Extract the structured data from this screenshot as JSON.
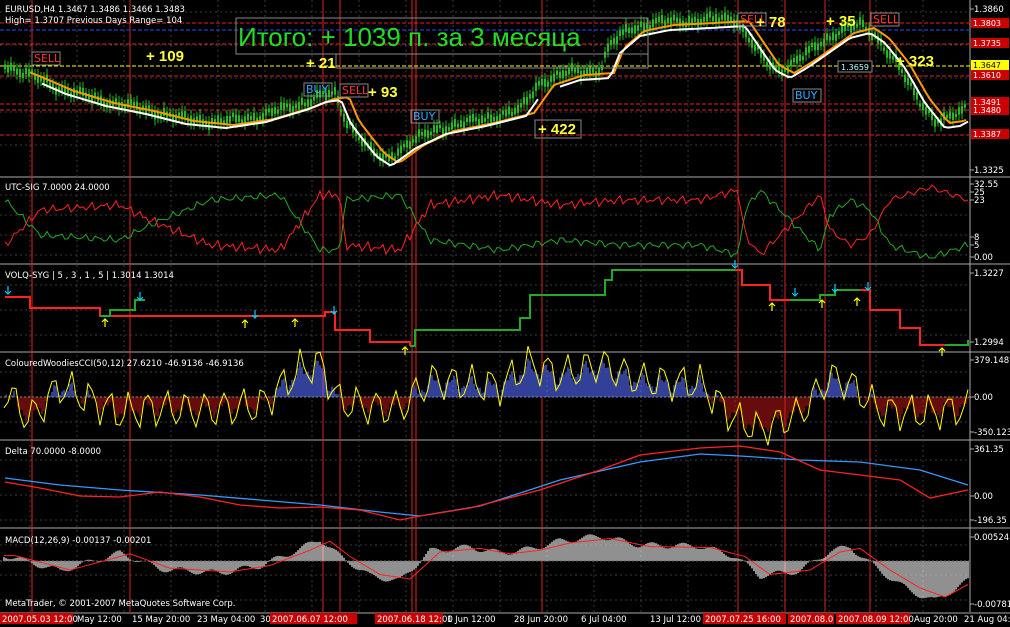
{
  "main": {
    "symbol_line": "EURUSD,H4  1.3467 1.3486 1.3466 1.3483",
    "range_line": "High= 1.3707    Previous Days Range= 104",
    "summary": "Итого: + 1039 п. за 3 месяца",
    "ticks": [
      "1.3860",
      "1.3325"
    ],
    "price_labels": [
      {
        "text": "1.3803",
        "bg": "#cc0000",
        "fg": "#ffffff"
      },
      {
        "text": "1.3735",
        "bg": "#cc0000",
        "fg": "#ffffff"
      },
      {
        "text": "1.3647",
        "bg": "#ffff00",
        "fg": "#000000"
      },
      {
        "text": "1.3610",
        "bg": "#cc0000",
        "fg": "#ffffff"
      },
      {
        "text": "1.3491",
        "bg": "#cc0000",
        "fg": "#ffffff"
      },
      {
        "text": "1.3480",
        "bg": "#cc0000",
        "fg": "#ffffff"
      },
      {
        "text": "1.3387",
        "bg": "#cc0000",
        "fg": "#ffffff"
      }
    ],
    "signals": [
      {
        "type": "sell",
        "text": "SELL"
      },
      {
        "type": "buy",
        "text": "BUY"
      },
      {
        "type": "sell",
        "text": "SELL"
      },
      {
        "type": "buy",
        "text": "BUY"
      },
      {
        "type": "sell",
        "text": "SELL"
      },
      {
        "type": "sell",
        "text": "SELL"
      },
      {
        "type": "buy",
        "text": "BUY"
      }
    ],
    "pips": [
      "+ 109",
      "+ 21",
      "+ 93",
      "+ 422",
      "+ 78",
      "+ 35",
      "+ 323"
    ],
    "box_label": "1.3659"
  },
  "utc": {
    "title": "UTC-SIG 7.0000 24.0000",
    "ticks": [
      "32.55",
      "25",
      "23",
      "8",
      "5",
      "0.00"
    ]
  },
  "volq": {
    "title": "VOLQ-SYG | 5 , 3 , 1 , 5  |  1.3014 1.3014",
    "ticks": [
      "1.3227",
      "1.2994"
    ]
  },
  "cci": {
    "title": "ColouredWoodiesCCI(50,12) 27.6210 -46.9136 -46.9136",
    "ticks": [
      "379.1487",
      "0.00",
      "-350.1239"
    ]
  },
  "delta": {
    "title": "Delta 70.0000 -8.0000",
    "ticks": [
      "361.35",
      "0.00",
      "-196.35"
    ]
  },
  "macd": {
    "title": "MACD(12,26,9) -0.00137 -0.00201",
    "ticks": [
      "0.00524",
      "-0.00781"
    ],
    "copyright": "MetaTrader, © 2001-2007 MetaQuotes Software Corp."
  },
  "dates": [
    {
      "text": "2007.05.03 12:00",
      "red": true
    },
    {
      "text": "May 12:00",
      "red": false
    },
    {
      "text": "15 May 20:00",
      "red": false
    },
    {
      "text": "23 May 04:00",
      "red": false
    },
    {
      "text": "30",
      "red": false
    },
    {
      "text": "2007.06.07 12:00",
      "red": true
    },
    {
      "text": "2007.06.18 12:00",
      "red": true
    },
    {
      "text": "1 Jun 12:00",
      "red": false
    },
    {
      "text": "28 Jun 20:00",
      "red": false
    },
    {
      "text": "6 Jul 04:00",
      "red": false
    },
    {
      "text": "13 Jul 12:00",
      "red": false
    },
    {
      "text": "2007.07.25 16:00",
      "red": true
    },
    {
      "text": "2007.08.0",
      "red": true
    },
    {
      "text": "2007.08.09 12:00",
      "red": true
    },
    {
      "text": "Aug 20:00",
      "red": false
    },
    {
      "text": "21 Aug 04:00",
      "red": false
    }
  ],
  "colors": {
    "grid": "#3a3a3a",
    "candle": "#22bb22",
    "ma_orange": "#ff9900",
    "ma_white": "#ffffff",
    "red": "#ff2222",
    "green": "#22aa22",
    "cci_pos": "#4455cc",
    "cci_neg": "#881111",
    "cci_line": "#ffff00",
    "delta_blue": "#3399ff",
    "macd_hist": "#c0c0c0"
  }
}
